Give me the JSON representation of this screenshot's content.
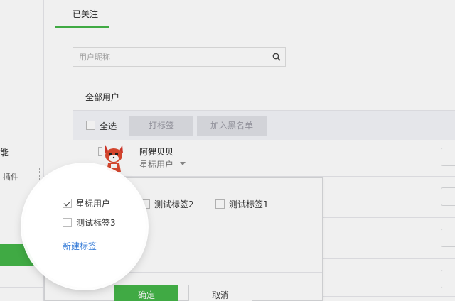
{
  "sidebar": {
    "feature_fragment": "能",
    "plugin_fragment": "插件"
  },
  "tabs": [
    {
      "label": "已关注",
      "active": true
    }
  ],
  "search": {
    "placeholder": "用户昵称",
    "value": "",
    "icon": "search-icon"
  },
  "user_list": {
    "header": "全部用户",
    "toolbar": {
      "select_all_label": "全选",
      "tag_button": "打标签",
      "blacklist_button": "加入黑名单"
    },
    "rows": [
      {
        "name": "阿狸贝贝",
        "tag": "星标用户",
        "avatar": "fox-avatar"
      }
    ]
  },
  "tag_popover": {
    "options": [
      {
        "label": "星标用户",
        "checked": true
      },
      {
        "label": "测试标签2",
        "checked": false
      },
      {
        "label": "测试标签1",
        "checked": false
      },
      {
        "label": "测试标签3",
        "checked": false
      }
    ],
    "new_tag_link": "新建标签",
    "confirm_button": "确定",
    "cancel_button": "取消"
  },
  "colors": {
    "accent_green": "#44b549",
    "link_blue": "#2f77d6",
    "toolbar_bg": "#f4f5f9",
    "disabled_button_bg": "#e0e1e6"
  }
}
